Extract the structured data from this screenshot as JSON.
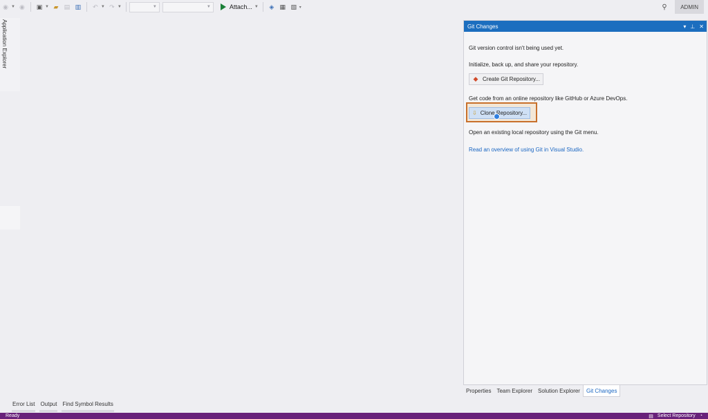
{
  "toolbar": {
    "attach_label": "Attach...",
    "admin_label": "ADMIN"
  },
  "left_tab": {
    "label": "Application Explorer"
  },
  "git_panel": {
    "title": "Git Changes",
    "not_used_text": "Git version control isn't being used yet.",
    "init_text": "Initialize, back up, and share your repository.",
    "create_button": "Create Git Repository...",
    "online_text": "Get code from an online repository like GitHub or Azure DevOps.",
    "clone_button": "Clone Repository...",
    "open_text": "Open an existing local repository using the Git menu.",
    "overview_link": "Read an overview of using Git in Visual Studio."
  },
  "right_tabs": [
    {
      "label": "Properties"
    },
    {
      "label": "Team Explorer"
    },
    {
      "label": "Solution Explorer"
    },
    {
      "label": "Git Changes"
    }
  ],
  "bottom_tabs": [
    {
      "label": "Error List"
    },
    {
      "label": "Output"
    },
    {
      "label": "Find Symbol Results"
    }
  ],
  "status_bar": {
    "left": "Ready",
    "right": "Select Repository"
  },
  "colors": {
    "accent": "#1c6ebf",
    "status_bar": "#68217a",
    "highlight": "#c8702b",
    "link": "#1a66c2"
  }
}
